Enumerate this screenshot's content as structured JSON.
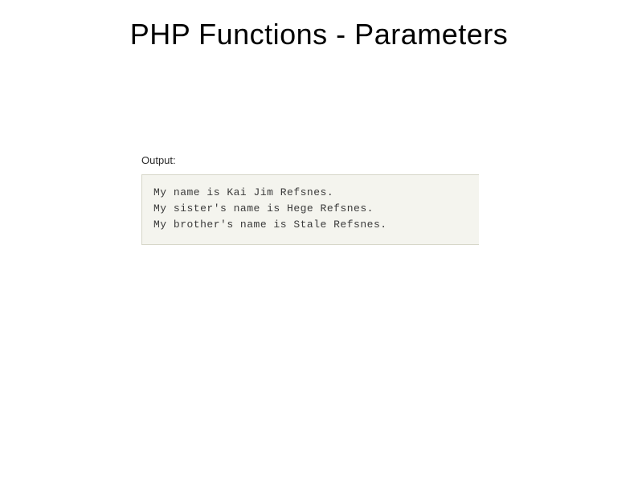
{
  "title": "PHP Functions - Parameters",
  "output": {
    "label": "Output:",
    "lines": {
      "l1": "My name is Kai Jim Refsnes.",
      "l2": "My sister's name is Hege Refsnes.",
      "l3": "My brother's name is Stale Refsnes."
    }
  }
}
